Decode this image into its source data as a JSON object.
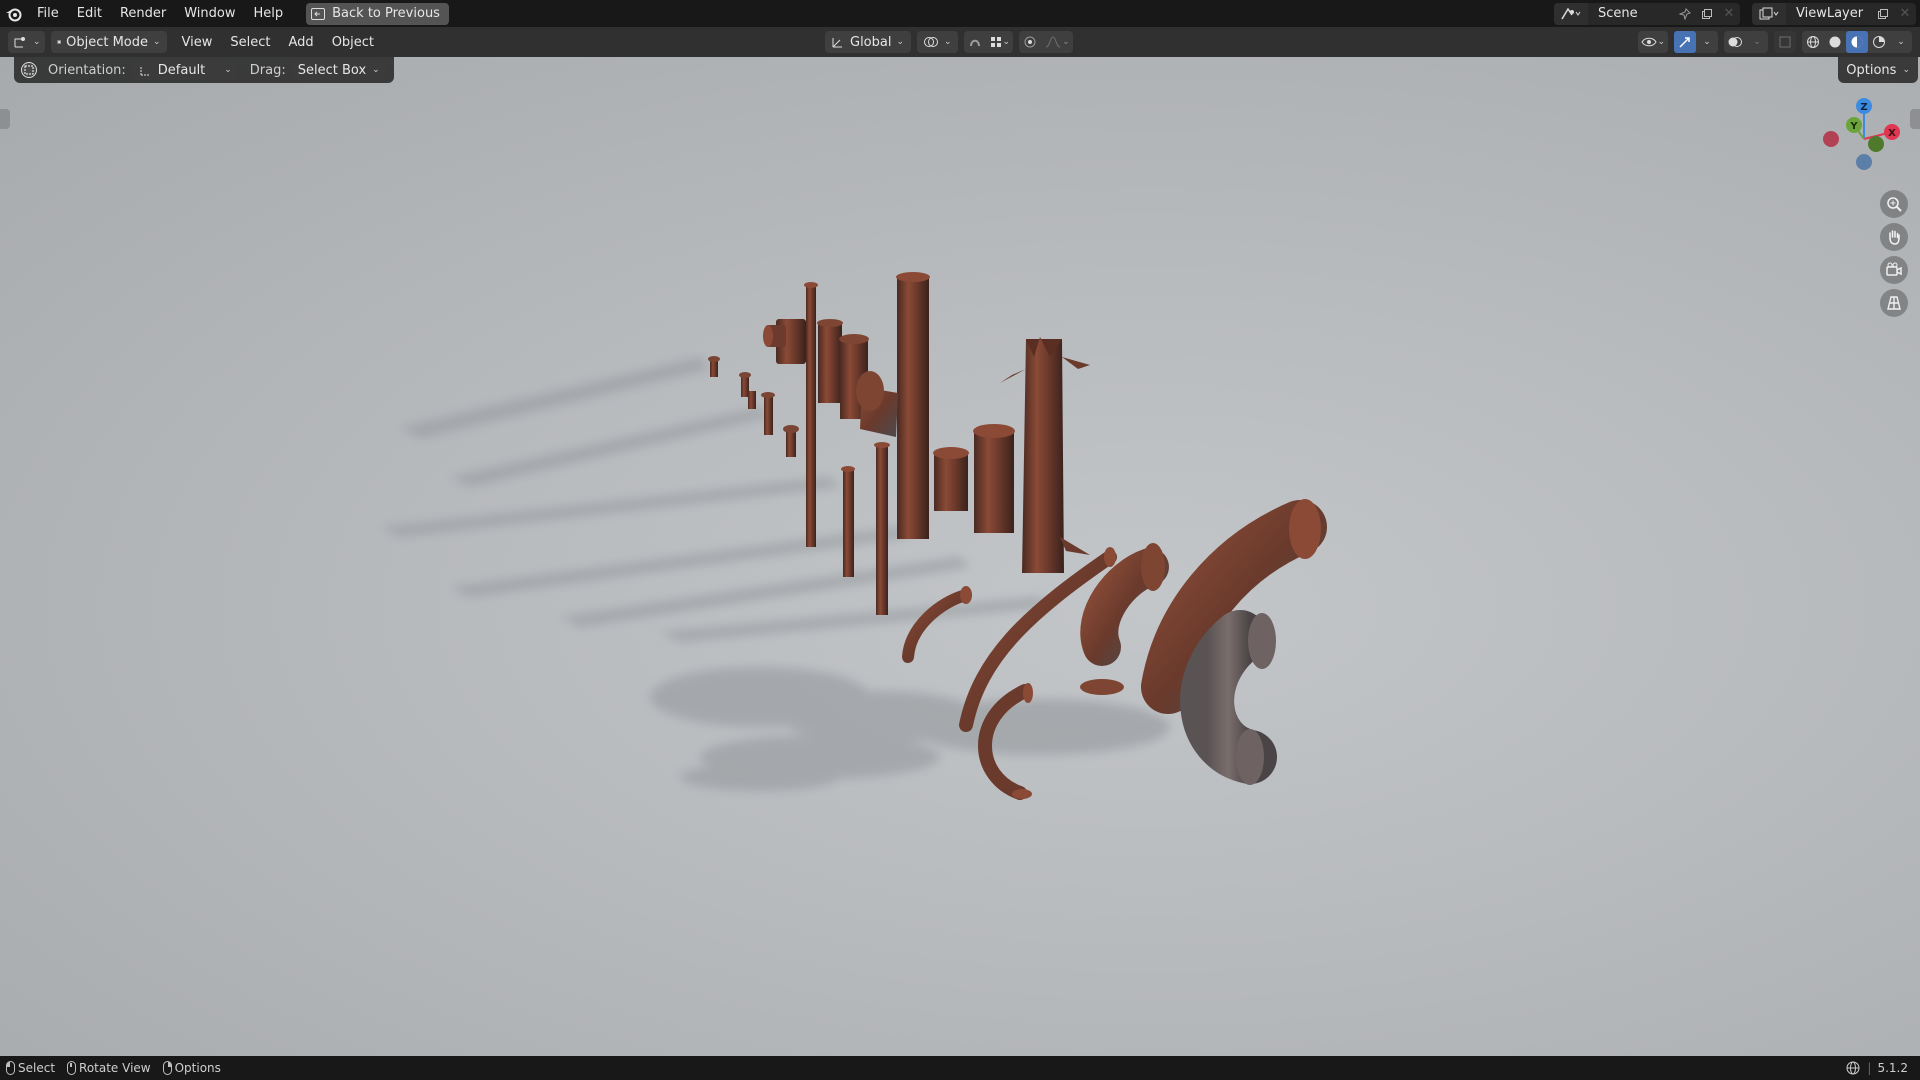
{
  "menu": {
    "items": [
      "File",
      "Edit",
      "Render",
      "Window",
      "Help"
    ],
    "back_button": "Back to Previous"
  },
  "workspace": {
    "scene_name": "Scene",
    "view_layer_name": "ViewLayer"
  },
  "header": {
    "mode": "Object Mode",
    "menus": [
      "View",
      "Select",
      "Add",
      "Object"
    ],
    "transform_orientation": "Global"
  },
  "tool_settings": {
    "orientation_label": "Orientation:",
    "orientation_value": "Default",
    "drag_label": "Drag:",
    "drag_value": "Select Box",
    "options_label": "Options"
  },
  "gizmo": {
    "x_label": "X",
    "y_label": "Y",
    "z_label": "Z",
    "x_color": "#e0364f",
    "y_color": "#6ba43a",
    "z_color": "#3b8ce0"
  },
  "viewport": {
    "shading": "solid",
    "objects": "rusty pipe kit"
  },
  "statusbar": {
    "select": "Select",
    "rotate": "Rotate View",
    "options": "Options",
    "version": "5.1.2"
  },
  "colors": {
    "accent": "#4772b3",
    "rust": "#7a4030"
  }
}
